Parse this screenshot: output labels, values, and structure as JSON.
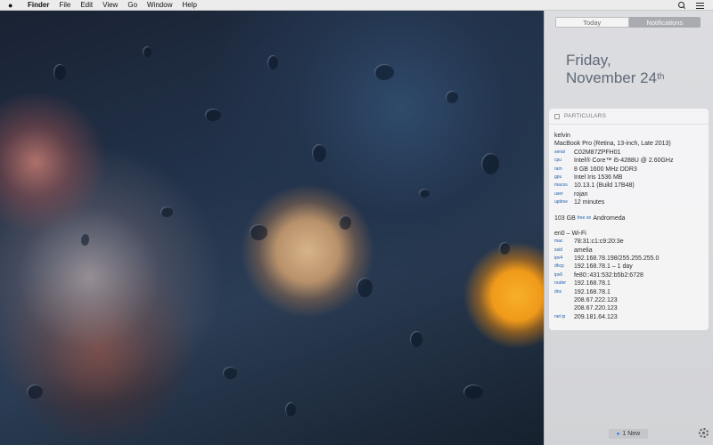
{
  "menubar": {
    "app": "Finder",
    "items": [
      "File",
      "Edit",
      "View",
      "Go",
      "Window",
      "Help"
    ]
  },
  "nc": {
    "tabs": {
      "today": "Today",
      "notifications": "Notifications"
    },
    "date_day": "Friday,",
    "date_month_day": "November 24",
    "date_suffix": "th",
    "widget": {
      "title": "PARTICULARS",
      "hostname": "kelvin",
      "model": "MacBook Pro (Retina, 13-inch, Late 2013)",
      "rows": [
        {
          "k": "serial",
          "v": "C02M87ZPFH01"
        },
        {
          "k": "cpu",
          "v": "Intel® Core™ i5-4288U @ 2.60GHz"
        },
        {
          "k": "ram",
          "v": "8 GB 1600 MHz DDR3"
        },
        {
          "k": "gpu",
          "v": "Intel Iris 1536 MB"
        },
        {
          "k": "macos",
          "v": "10.13.1 (Build 17B48)"
        },
        {
          "k": "user",
          "v": "rojan"
        },
        {
          "k": "uptime",
          "v": "12 minutes"
        }
      ],
      "disk_amount": "103 GB",
      "disk_label": "free on",
      "disk_name": "Andromeda",
      "iface": "en0 – Wi-Fi",
      "net_rows": [
        {
          "k": "mac",
          "v": "78:31:c1:c9:20:3e"
        },
        {
          "k": "ssid",
          "v": "amelia"
        },
        {
          "k": "ipv4",
          "v": "192.168.78.198/255.255.255.0"
        },
        {
          "k": "dhcp",
          "v": "192.168.78.1 – 1 day"
        },
        {
          "k": "ipv6",
          "v": "fe80::431:532:b5b2:6728"
        },
        {
          "k": "router",
          "v": "192.168.78.1"
        },
        {
          "k": "dns",
          "v": "192.168.78.1"
        },
        {
          "k": "",
          "v": "208.67.222.123"
        },
        {
          "k": "",
          "v": "208.67.220.123"
        },
        {
          "k": "net ip",
          "v": "209.181.64.123"
        }
      ]
    },
    "new_label": "1 New"
  },
  "colors": {
    "accent_blue": "#1f5ea8",
    "bokeh_orange": "#f7b02a"
  }
}
